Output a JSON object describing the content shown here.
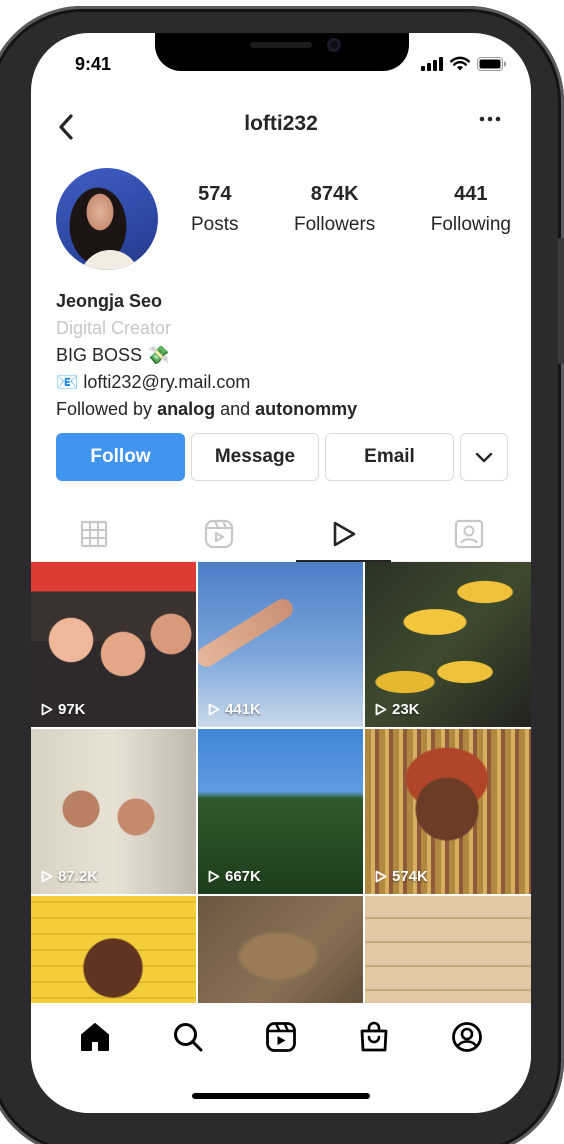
{
  "status_bar": {
    "time": "9:41"
  },
  "nav": {
    "username": "lofti232"
  },
  "profile": {
    "stats": [
      {
        "value": "574",
        "label": "Posts"
      },
      {
        "value": "874K",
        "label": "Followers"
      },
      {
        "value": "441",
        "label": "Following"
      }
    ],
    "name": "Jeongja Seo",
    "category": "Digital Creator",
    "bio_line": "BIG BOSS 💸",
    "email_line": "📧 lofti232@ry.mail.com",
    "followed_by_prefix": "Followed by",
    "followed_by_user1": "analog",
    "followed_by_joiner": "and",
    "followed_by_user2": "autonommy"
  },
  "actions": {
    "follow_label": "Follow",
    "message_label": "Message",
    "email_label": "Email"
  },
  "tabs": [
    {
      "icon": "grid-icon",
      "active": false
    },
    {
      "icon": "reels-icon",
      "active": false
    },
    {
      "icon": "play-icon",
      "active": true
    },
    {
      "icon": "tagged-icon",
      "active": false
    }
  ],
  "videos": [
    {
      "views": "97K"
    },
    {
      "views": "441K"
    },
    {
      "views": "23K"
    },
    {
      "views": "87.2K"
    },
    {
      "views": "667K"
    },
    {
      "views": "574K"
    },
    {
      "views": ""
    },
    {
      "views": ""
    },
    {
      "views": ""
    }
  ],
  "bottom_nav": [
    "home-icon",
    "search-icon",
    "reels-icon",
    "shop-icon",
    "profile-icon"
  ],
  "colors": {
    "follow_blue": "#4294f1",
    "text": "#262626",
    "muted": "#c7c7c7"
  }
}
